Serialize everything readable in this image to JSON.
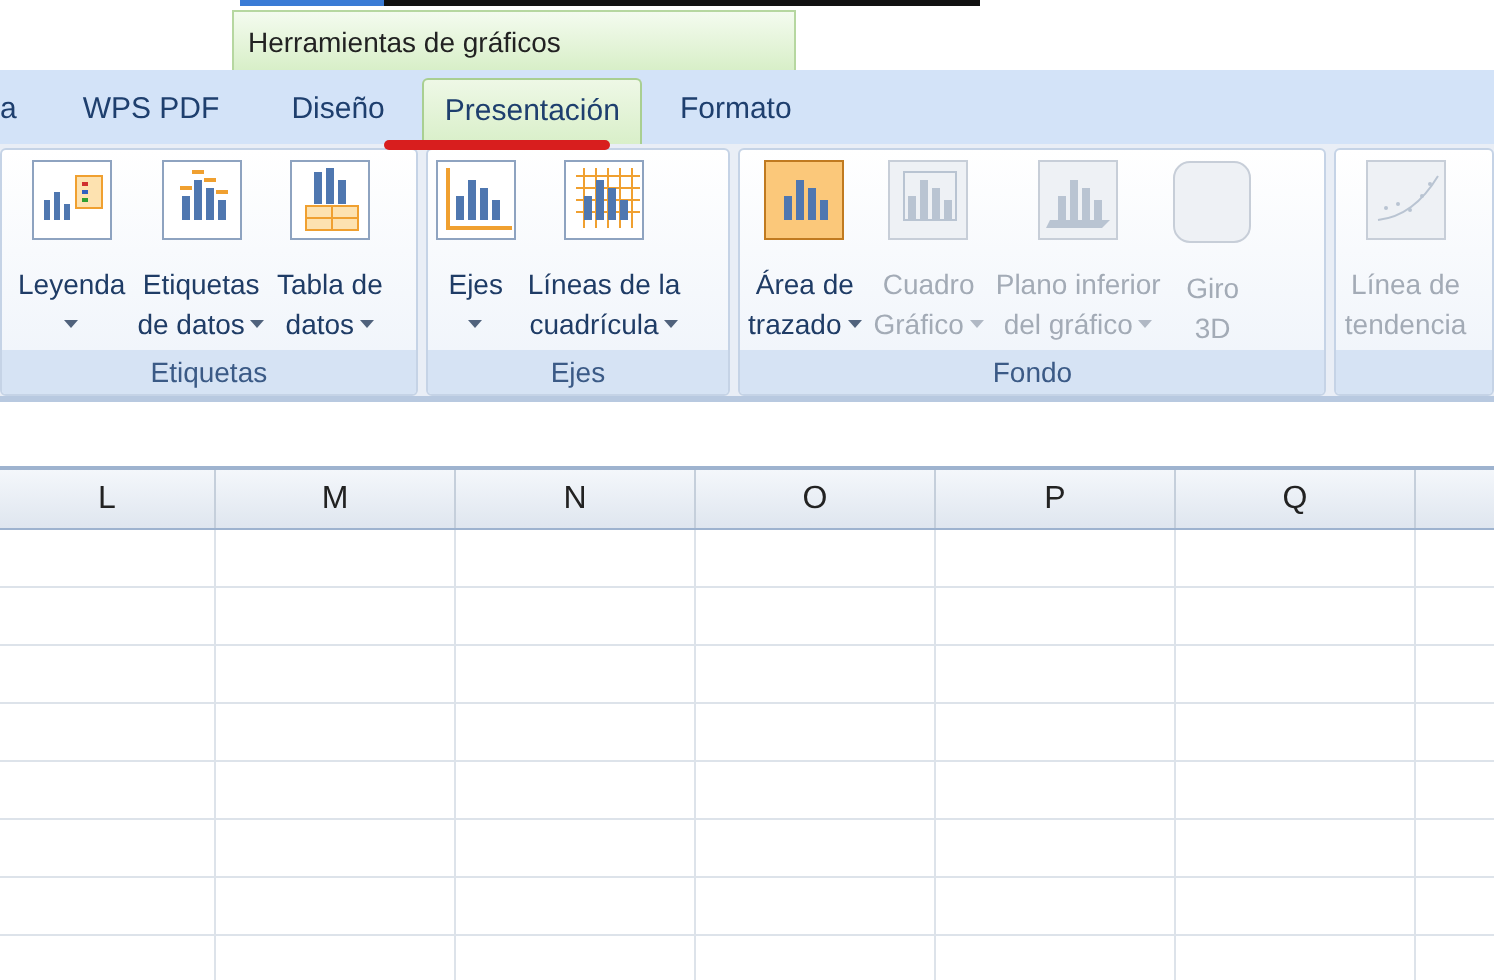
{
  "context_tab": {
    "label": "Herramientas de gráficos"
  },
  "tabs": [
    {
      "label": "a",
      "selected": false
    },
    {
      "label": "WPS PDF",
      "selected": false
    },
    {
      "label": "Diseño",
      "selected": false
    },
    {
      "label": "Presentación",
      "selected": true
    },
    {
      "label": "Formato",
      "selected": false
    }
  ],
  "ribbon_groups": [
    {
      "label": "Etiquetas",
      "buttons": [
        {
          "kind": "legend",
          "lines": [
            "Leyenda"
          ],
          "dropdown": true,
          "disabled": false,
          "highlighted": false
        },
        {
          "kind": "data-labels",
          "lines": [
            "Etiquetas",
            "de datos"
          ],
          "dropdown": true,
          "disabled": false,
          "highlighted": false
        },
        {
          "kind": "data-table",
          "lines": [
            "Tabla de",
            "datos"
          ],
          "dropdown": true,
          "disabled": false,
          "highlighted": false
        }
      ]
    },
    {
      "label": "Ejes",
      "buttons": [
        {
          "kind": "axes",
          "lines": [
            "Ejes"
          ],
          "dropdown": true,
          "disabled": false,
          "highlighted": false
        },
        {
          "kind": "gridlines",
          "lines": [
            "Líneas de la",
            "cuadrícula"
          ],
          "dropdown": true,
          "disabled": false,
          "highlighted": false
        }
      ]
    },
    {
      "label": "Fondo",
      "buttons": [
        {
          "kind": "plot-area",
          "lines": [
            "Área de",
            "trazado"
          ],
          "dropdown": true,
          "disabled": false,
          "highlighted": true
        },
        {
          "kind": "chart-wall",
          "lines": [
            "Cuadro",
            "Gráfico"
          ],
          "dropdown": true,
          "disabled": true,
          "highlighted": false
        },
        {
          "kind": "chart-floor",
          "lines": [
            "Plano inferior",
            "del gráfico"
          ],
          "dropdown": true,
          "disabled": true,
          "highlighted": false
        },
        {
          "kind": "rotation",
          "lines": [
            "Giro",
            "3D"
          ],
          "dropdown": false,
          "disabled": true,
          "highlighted": false
        }
      ]
    },
    {
      "buttons": [
        {
          "kind": "trendline",
          "lines": [
            "Línea de",
            "tendencia"
          ],
          "dropdown": false,
          "disabled": true,
          "highlighted": false
        }
      ]
    }
  ],
  "columns": [
    "L",
    "M",
    "N",
    "O",
    "P",
    "Q"
  ]
}
